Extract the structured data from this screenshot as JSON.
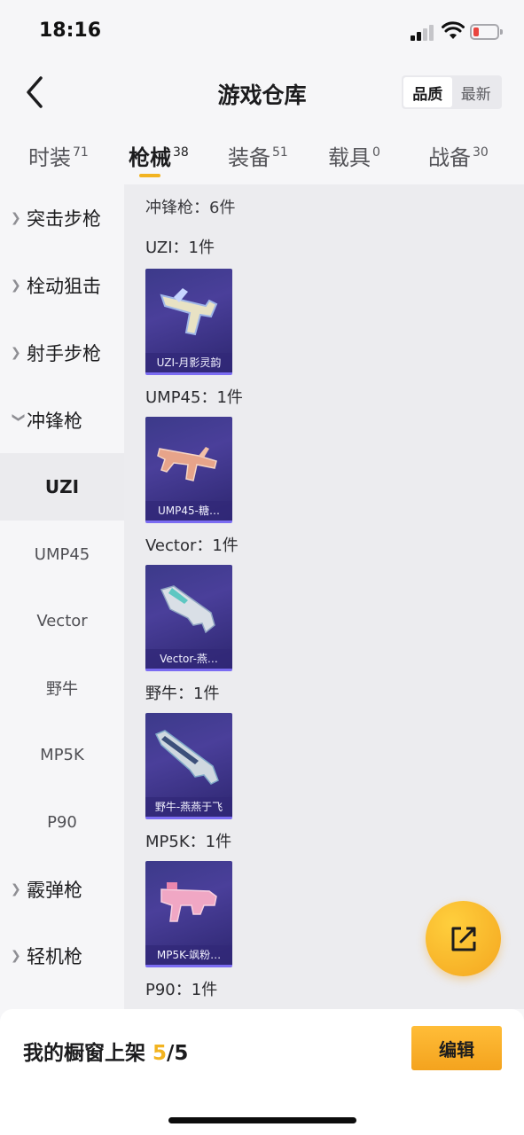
{
  "status": {
    "time": "18:16"
  },
  "nav": {
    "title": "游戏仓库",
    "sort": [
      {
        "label": "品质",
        "active": true
      },
      {
        "label": "最新",
        "active": false
      }
    ]
  },
  "tabs": [
    {
      "label": "时装",
      "count": "71"
    },
    {
      "label": "枪械",
      "count": "38"
    },
    {
      "label": "装备",
      "count": "51"
    },
    {
      "label": "载具",
      "count": "0"
    },
    {
      "label": "战备",
      "count": "30"
    }
  ],
  "active_tab": "枪械",
  "sidebar": {
    "groups": [
      {
        "label": "突击步枪",
        "expanded": false
      },
      {
        "label": "栓动狙击",
        "expanded": false
      },
      {
        "label": "射手步枪",
        "expanded": false
      },
      {
        "label": "冲锋枪",
        "expanded": true
      },
      {
        "label": "霰弹枪",
        "expanded": false
      },
      {
        "label": "轻机枪",
        "expanded": false
      }
    ],
    "sub_items": [
      "UZI",
      "UMP45",
      "Vector",
      "野牛",
      "MP5K",
      "P90"
    ],
    "selected": "UZI"
  },
  "content": {
    "summary": "冲锋枪：6件",
    "sections": [
      {
        "label": "UZI：1件",
        "skin": "UZI-月影灵韵",
        "gun_color": "#e8e2c4"
      },
      {
        "label": "UMP45：1件",
        "skin": "UMP45-糖…",
        "gun_color": "#e7a48a"
      },
      {
        "label": "Vector：1件",
        "skin": "Vector-燕…",
        "gun_color": "#d9dfe6"
      },
      {
        "label": "野牛：1件",
        "skin": "野牛-燕燕于飞",
        "gun_color": "#cfd8e0"
      },
      {
        "label": "MP5K：1件",
        "skin": "MP5K-飒粉…",
        "gun_color": "#f0a7c4"
      },
      {
        "label": "P90：1件"
      }
    ]
  },
  "share_button": {
    "icon": "share-icon"
  },
  "bottom": {
    "showcase_prefix": "我的橱窗上架",
    "showcase_used": "5",
    "showcase_total": "/5",
    "edit_label": "编辑"
  },
  "colors": {
    "accent": "#f2b320",
    "card": "#3c3a8a"
  }
}
